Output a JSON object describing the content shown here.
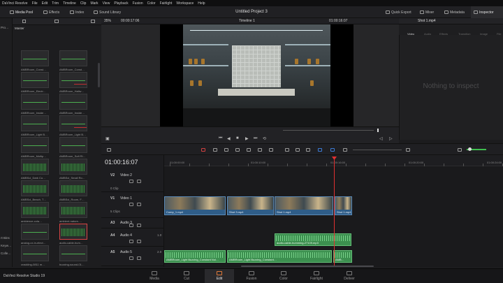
{
  "menu": [
    "DaVinci Resolve",
    "File",
    "Edit",
    "Trim",
    "Timeline",
    "Clip",
    "Mark",
    "View",
    "Playback",
    "Fusion",
    "Color",
    "Fairlight",
    "Workspace",
    "Help"
  ],
  "toolbar": {
    "media_pool": "Media Pool",
    "effects": "Effects",
    "index": "Index",
    "sound_library": "Sound Library",
    "project_title": "Untitled Project 3",
    "quick_export": "Quick Export",
    "mixer": "Mixer",
    "metadata": "Metadata",
    "inspector": "Inspector"
  },
  "media_pool": {
    "sidebar_top": "Pro…",
    "master": "Master",
    "smart_bins": "rt Bins",
    "keywords": "Keyw…",
    "collections": "Colle…",
    "clips": [
      {
        "label": "AMBRoom_Const…",
        "type": "line"
      },
      {
        "label": "AMBRoom_Const…",
        "type": "line"
      },
      {
        "label": "AMBRoom_Electr…",
        "type": "line"
      },
      {
        "label": "AMBRoom_Hallw…",
        "type": "line-red"
      },
      {
        "label": "AMBRoom_Inside…",
        "type": "line"
      },
      {
        "label": "AMBRoom_Inside…",
        "type": "line"
      },
      {
        "label": "AMBRoom_Light B…",
        "type": "line"
      },
      {
        "label": "AMBRoom_Light B…",
        "type": "line-red"
      },
      {
        "label": "AMBRoom_Multip…",
        "type": "line"
      },
      {
        "label": "AMBRoom_Soft Ri…",
        "type": "line"
      },
      {
        "label": "AMBSci_Dark Co…",
        "type": "wave"
      },
      {
        "label": "AMBSci_Small Ro…",
        "type": "wave"
      },
      {
        "label": "AMBSci_Beach, T…",
        "type": "wave"
      },
      {
        "label": "AMBSci_Room, F…",
        "type": "wave"
      },
      {
        "label": "ambience-cola…",
        "type": "wave"
      },
      {
        "label": "ambient-nature-…",
        "type": "wave"
      },
      {
        "label": "analog-cx-in-elect…",
        "type": "line"
      },
      {
        "label": "audio-cable-hum…",
        "type": "wave-sel"
      },
      {
        "label": "crackling-0811 m…",
        "type": "line"
      },
      {
        "label": "buzzing-sound-01…",
        "type": "line"
      }
    ]
  },
  "viewer": {
    "zoom": "35%",
    "source_tc": "00:00:17:06",
    "timeline_name": "Timeline 1",
    "record_tc": "01:00:16:07"
  },
  "inspector": {
    "clip_name": "Shot 1.mp4",
    "tabs": [
      "Video",
      "Audio",
      "Effects",
      "Transition",
      "Image",
      "File"
    ],
    "empty_text": "Nothing to inspect"
  },
  "timeline": {
    "timecode": "01:00:16:07",
    "ruler": [
      "01:00:00:00",
      "01:00:10:00",
      "01:00:16:00",
      "01:00:20:00",
      "01:00:24:00"
    ],
    "tracks": [
      {
        "id": "V2",
        "name": "Video 2",
        "count": "0 Clip"
      },
      {
        "id": "V1",
        "name": "Video 1",
        "count": "5 Clips"
      },
      {
        "id": "A3",
        "name": "Audio 3",
        "count": ""
      },
      {
        "id": "A4",
        "name": "Audio 4",
        "count": "1.0"
      },
      {
        "id": "A5",
        "name": "Audio 5",
        "count": "2.0"
      }
    ],
    "video_clips": [
      "Comp_1.mp4",
      "Shot 3.mp4",
      "Shot 1.mp4",
      "Shot 1.mp4"
    ],
    "audio_clips": [
      "audio-cable-humming-27109.mp3",
      "AMBRoom_Light Buzzing_Constant Noi…",
      "AMBRoom_Light Buzzing_Constant…",
      "AMB…"
    ]
  },
  "pages": [
    "Media",
    "Cut",
    "Edit",
    "Fusion",
    "Color",
    "Fairlight",
    "Deliver"
  ],
  "active_page": "Edit",
  "brand": "DaVinci Resolve Studio 19",
  "colors": {
    "accent": "#e07a3a",
    "audio_clip": "#3c8f4f",
    "video_clip": "#2f5d88",
    "playhead": "#e03030"
  }
}
